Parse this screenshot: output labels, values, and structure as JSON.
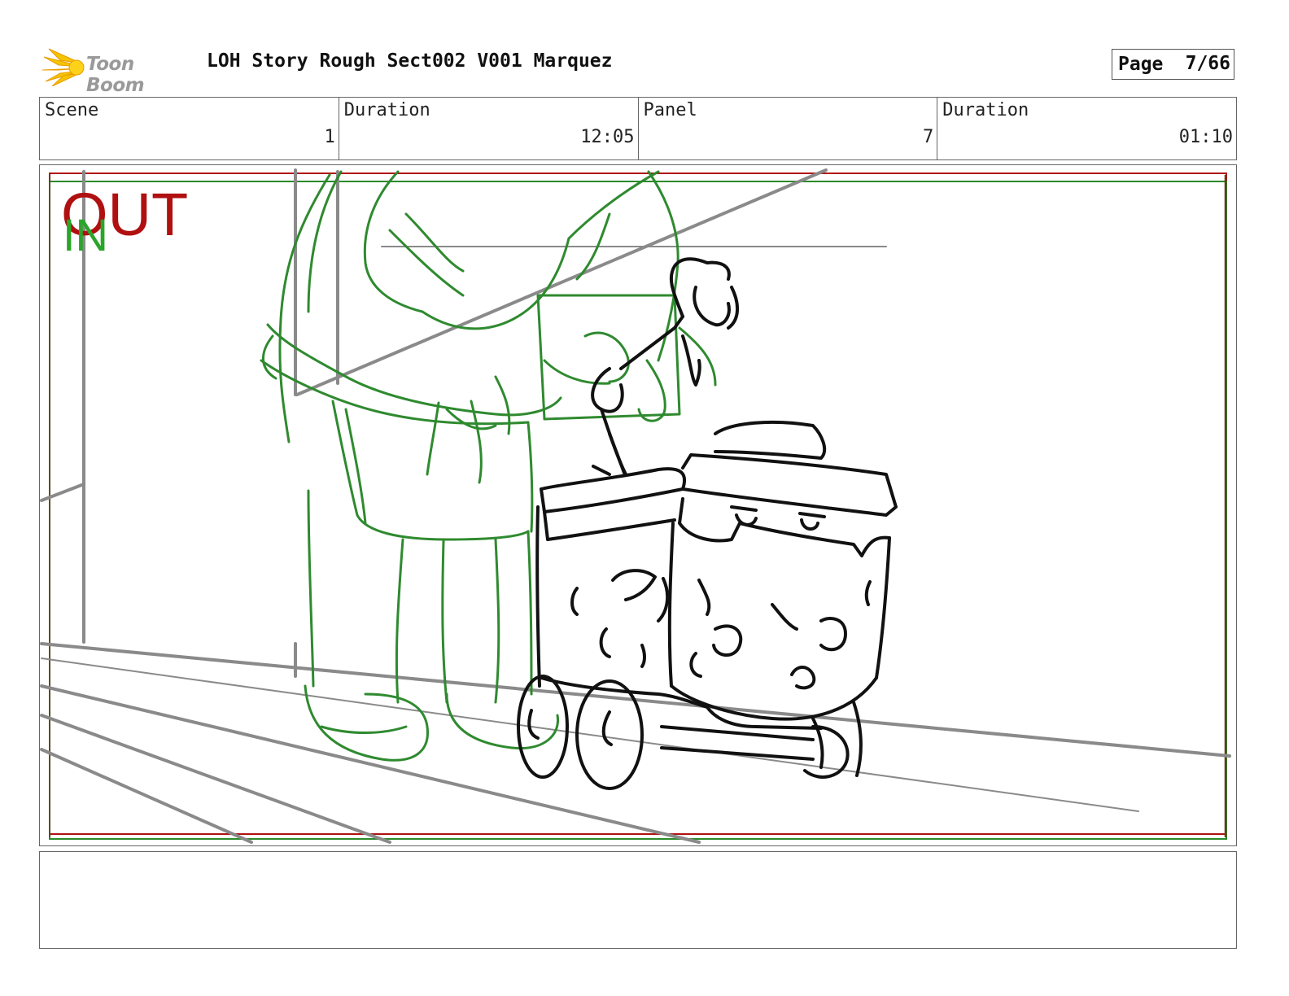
{
  "header": {
    "logo_text": "Toon Boom",
    "project_title": "LOH Story Rough Sect002 V001 Marquez",
    "page_label": "Page",
    "page_value": "7/66"
  },
  "info": {
    "scene_label": "Scene",
    "scene_value": "1",
    "scene_duration_label": "Duration",
    "scene_duration_value": "12:05",
    "panel_label": "Panel",
    "panel_value": "7",
    "panel_duration_label": "Duration",
    "panel_duration_value": "01:10"
  },
  "panel_overlay": {
    "out_label": "OUT",
    "in_label": "IN"
  },
  "colors": {
    "out_frame": "#b01010",
    "in_frame": "#2a8a2a",
    "rough_sketch": "#2f8a2f",
    "clean_sketch": "#111111",
    "background_lines": "#8a8a8a"
  },
  "notes": {
    "text": ""
  }
}
